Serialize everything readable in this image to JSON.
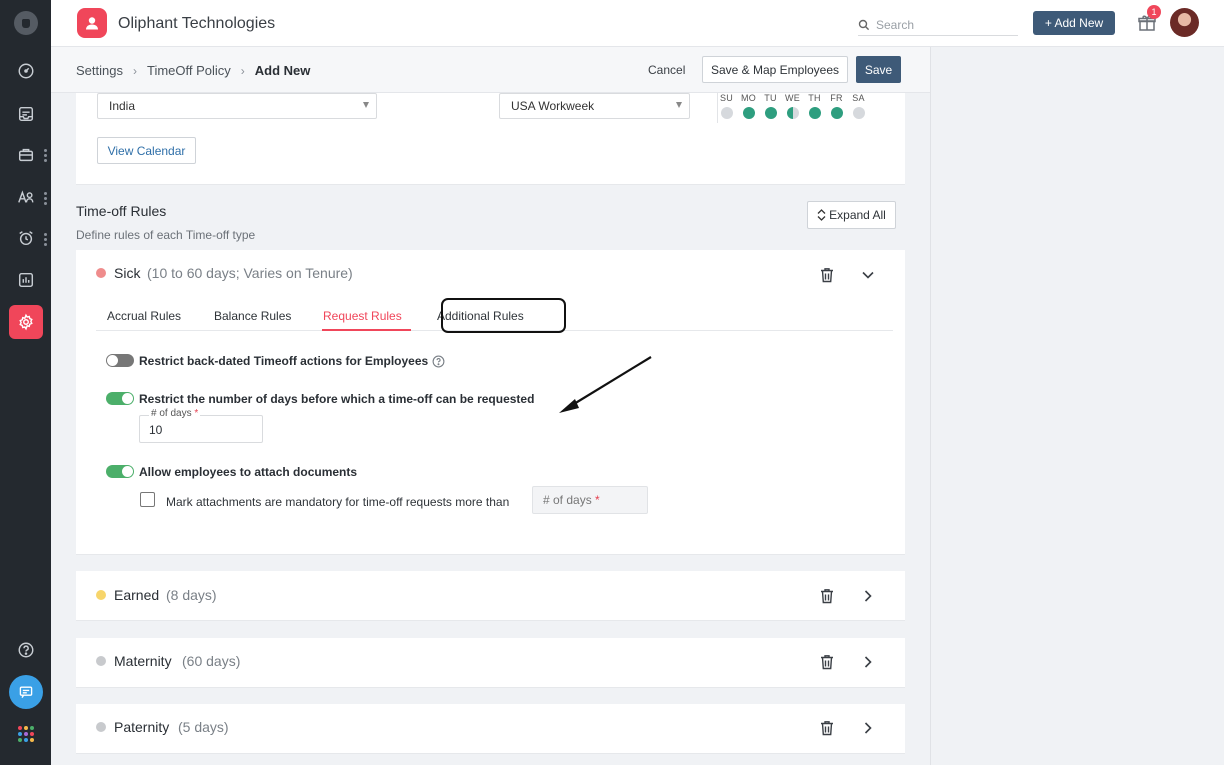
{
  "app": {
    "company_name": "Oliphant Technologies",
    "search_placeholder": "Search",
    "add_new_label": "+ Add New",
    "notifications_count": "1"
  },
  "breadcrumb": {
    "items": [
      "Settings",
      "TimeOff Policy"
    ],
    "current": "Add New"
  },
  "actions": {
    "cancel_label": "Cancel",
    "save_map_label": "Save & Map Employees",
    "save_label": "Save"
  },
  "calendar": {
    "country": "India",
    "workweek": "USA Workweek",
    "view_calendar_label": "View Calendar",
    "days": [
      {
        "label": "SU",
        "status": "off"
      },
      {
        "label": "MO",
        "status": "on"
      },
      {
        "label": "TU",
        "status": "on"
      },
      {
        "label": "WE",
        "status": "half"
      },
      {
        "label": "TH",
        "status": "on"
      },
      {
        "label": "FR",
        "status": "on"
      },
      {
        "label": "SA",
        "status": "off"
      }
    ]
  },
  "rules_section": {
    "title": "Time-off Rules",
    "subtitle": "Define rules of each Time-off type",
    "expand_all_label": "Expand All"
  },
  "timeoff_types": [
    {
      "name": "Sick",
      "detail": "(10 to 60 days; Varies on Tenure)",
      "color": "#ef8c8c"
    },
    {
      "name": "Earned",
      "detail": "(8 days)",
      "color": "#f7d56b"
    },
    {
      "name": "Maternity",
      "detail": "(60 days)",
      "color": "#c8cacd"
    },
    {
      "name": "Paternity",
      "detail": "(5 days)",
      "color": "#c8cacd"
    }
  ],
  "tabs": [
    {
      "label": "Accrual Rules"
    },
    {
      "label": "Balance Rules"
    },
    {
      "label": "Request Rules"
    },
    {
      "label": "Additional Rules"
    }
  ],
  "request_rules": {
    "restrict_backdated_label": "Restrict back-dated Timeoff actions for Employees",
    "restrict_days_label": "Restrict the number of days before which a time-off can be requested",
    "days_field_label": "# of days",
    "days_field_required": "*",
    "days_field_value": "10",
    "attach_docs_label": "Allow employees to attach documents",
    "mandatory_label": "Mark attachments are mandatory for time-off requests more than",
    "mandatory_days_placeholder": "# of days",
    "mandatory_days_required": "*"
  },
  "colors": {
    "accent": "#f0465a",
    "primary_button": "#3e5a78",
    "toggle_on": "#4caf6a",
    "workday_on": "#2e9e7f",
    "workday_off": "#d6d9dd"
  },
  "icons": {
    "rail": [
      "dashboard-icon",
      "inbox-icon",
      "briefcase-icon",
      "people-icon",
      "alarm-icon",
      "report-icon",
      "settings-icon",
      "help-icon",
      "chat-icon",
      "apps-grid-icon"
    ]
  }
}
